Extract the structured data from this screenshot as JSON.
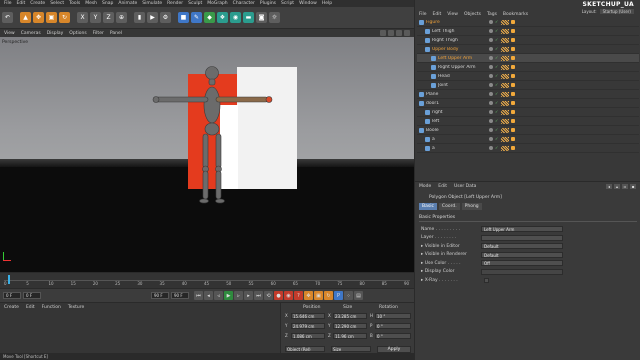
{
  "menubar": [
    "File",
    "Edit",
    "Create",
    "Select",
    "Tools",
    "Mesh",
    "Snap",
    "Animate",
    "Simulate",
    "Render",
    "Sculpt",
    "MoGraph",
    "Character",
    "Plugins",
    "Script",
    "Window",
    "Help"
  ],
  "toolbar": {
    "buttons": [
      {
        "icon": "undo-icon",
        "glyph": "↶",
        "color": "gr"
      },
      {
        "icon": "pointer-icon",
        "glyph": "▲",
        "color": "o"
      },
      {
        "icon": "move-icon",
        "glyph": "✥",
        "color": "o"
      },
      {
        "icon": "scale-icon",
        "glyph": "▣",
        "color": "o"
      },
      {
        "icon": "rotate-icon",
        "glyph": "↻",
        "color": "o"
      },
      {
        "icon": "x-axis-icon",
        "glyph": "X",
        "color": "gr"
      },
      {
        "icon": "y-axis-icon",
        "glyph": "Y",
        "color": "gr"
      },
      {
        "icon": "z-axis-icon",
        "glyph": "Z",
        "color": "gr"
      },
      {
        "icon": "coordinate-system-icon",
        "glyph": "⊕",
        "color": "gr"
      },
      {
        "icon": "render-region-icon",
        "glyph": "▮",
        "color": "gr"
      },
      {
        "icon": "render-view-icon",
        "glyph": "▶",
        "color": "gr"
      },
      {
        "icon": "render-settings-icon",
        "glyph": "⚙",
        "color": "gr"
      },
      {
        "icon": "cube-icon",
        "glyph": "■",
        "color": "b"
      },
      {
        "icon": "pen-icon",
        "glyph": "✎",
        "color": "b"
      },
      {
        "icon": "subdivision-icon",
        "glyph": "◆",
        "color": "g"
      },
      {
        "icon": "array-icon",
        "glyph": "❖",
        "color": "t"
      },
      {
        "icon": "deformer-icon",
        "glyph": "◉",
        "color": "t"
      },
      {
        "icon": "floor-icon",
        "glyph": "▬",
        "color": "t"
      },
      {
        "icon": "camera-icon",
        "glyph": "◙",
        "color": "gr"
      },
      {
        "icon": "light-icon",
        "glyph": "☼",
        "color": "gr"
      }
    ]
  },
  "viewport": {
    "menu": [
      "View",
      "Cameras",
      "Display",
      "Options",
      "Filter",
      "Panel"
    ],
    "label": "Perspective"
  },
  "object_manager": {
    "brand": "SKETCHUP_UA",
    "layout_label": "Layout:",
    "layout_value": "Startup (User)",
    "menu": [
      "File",
      "Edit",
      "View",
      "Objects",
      "Tags",
      "Bookmarks"
    ],
    "rows": [
      {
        "label": "Figure",
        "indent": 0,
        "orange": true,
        "selected": false
      },
      {
        "label": "Left Thigh",
        "indent": 1,
        "orange": false,
        "selected": false
      },
      {
        "label": "Right Thigh",
        "indent": 1,
        "orange": false,
        "selected": false
      },
      {
        "label": "Upper Body",
        "indent": 1,
        "orange": true,
        "selected": false
      },
      {
        "label": "Left Upper Arm",
        "indent": 2,
        "orange": true,
        "selected": true
      },
      {
        "label": "Right Upper Arm",
        "indent": 2,
        "orange": false,
        "selected": false
      },
      {
        "label": "Head",
        "indent": 2,
        "orange": false,
        "selected": false
      },
      {
        "label": "Joint",
        "indent": 2,
        "orange": false,
        "selected": false
      },
      {
        "label": "Plane",
        "indent": 0,
        "orange": false,
        "selected": false
      },
      {
        "label": "door1",
        "indent": 0,
        "orange": false,
        "selected": false
      },
      {
        "label": "right",
        "indent": 1,
        "orange": false,
        "selected": false
      },
      {
        "label": "left",
        "indent": 1,
        "orange": false,
        "selected": false
      },
      {
        "label": "Boole",
        "indent": 0,
        "orange": false,
        "selected": false
      },
      {
        "label": "a",
        "indent": 1,
        "orange": false,
        "selected": false
      },
      {
        "label": "a",
        "indent": 1,
        "orange": false,
        "selected": false
      }
    ]
  },
  "attribute_manager": {
    "menu": [
      "Mode",
      "Edit",
      "User Data"
    ],
    "title": "Polygon Object [Left Upper Arm]",
    "tabs": [
      "Basic",
      "Coord.",
      "Phong"
    ],
    "section": "Basic Properties",
    "props": [
      {
        "label": "Name . . . . . . . . .",
        "value": "Left Upper Arm",
        "dim": false
      },
      {
        "label": "Layer . . . . . . . .",
        "value": "",
        "dim": false
      },
      {
        "label": "▸ Visible in Editor",
        "value": "Default",
        "dim": false
      },
      {
        "label": "▸ Visible in Renderer",
        "value": "Default",
        "dim": false
      },
      {
        "label": "▸ Use Color . . . . .",
        "value": "Off",
        "dim": false
      },
      {
        "label": "▸ Display Color",
        "value": "",
        "dim": true
      },
      {
        "label": "▸ X-Ray . . . . . . .",
        "value": "",
        "dim": false
      }
    ]
  },
  "timeline": {
    "labels": [
      "0",
      "5",
      "10",
      "15",
      "20",
      "25",
      "30",
      "35",
      "40",
      "45",
      "50",
      "55",
      "60",
      "65",
      "70",
      "75",
      "80",
      "85",
      "90"
    ],
    "current_frame": 0
  },
  "transport": {
    "start_frame": "0 F",
    "field2": "0 F",
    "end_frame": "90 F",
    "field4": "90 F",
    "buttons": [
      {
        "icon": "go-start-icon",
        "glyph": "⏮",
        "color": ""
      },
      {
        "icon": "prev-key-icon",
        "glyph": "◂",
        "color": ""
      },
      {
        "icon": "prev-frame-icon",
        "glyph": "◃",
        "color": ""
      },
      {
        "icon": "play-icon",
        "glyph": "▶",
        "color": "g"
      },
      {
        "icon": "next-frame-icon",
        "glyph": "▹",
        "color": ""
      },
      {
        "icon": "next-key-icon",
        "glyph": "▸",
        "color": ""
      },
      {
        "icon": "go-end-icon",
        "glyph": "⏭",
        "color": ""
      },
      {
        "icon": "loop-icon",
        "glyph": "⟲",
        "color": ""
      },
      {
        "icon": "record-icon",
        "glyph": "●",
        "color": "r"
      },
      {
        "icon": "autokey-icon",
        "glyph": "◉",
        "color": "r"
      },
      {
        "icon": "keyframe-selection-icon",
        "glyph": "?",
        "color": "r"
      },
      {
        "icon": "position-key-icon",
        "glyph": "✥",
        "color": "o"
      },
      {
        "icon": "scale-key-icon",
        "glyph": "▣",
        "color": "o"
      },
      {
        "icon": "rotation-key-icon",
        "glyph": "↻",
        "color": "o"
      },
      {
        "icon": "param-key-icon",
        "glyph": "P",
        "color": "b"
      },
      {
        "icon": "point-key-icon",
        "glyph": "⁘",
        "color": ""
      },
      {
        "icon": "timeline-icon",
        "glyph": "▤",
        "color": ""
      }
    ]
  },
  "material_manager": {
    "menu": [
      "Create",
      "Edit",
      "Function",
      "Texture"
    ]
  },
  "coordinates": {
    "headers": [
      "Position",
      "Size",
      "Rotation"
    ],
    "rows": [
      {
        "axis": "X",
        "pos": "15.646 cm",
        "size_axis": "X",
        "size": "23.285 cm",
        "rot_axis": "H",
        "rot": "10 °"
      },
      {
        "axis": "Y",
        "pos": "24.979 cm",
        "size_axis": "Y",
        "size": "12.290 cm",
        "rot_axis": "P",
        "rot": "0 °"
      },
      {
        "axis": "Z",
        "pos": "1.086 cm",
        "size_axis": "Z",
        "size": "11.96 cm",
        "rot_axis": "B",
        "rot": "0 °"
      }
    ],
    "mode": "Object (Rel)",
    "size_mode": "Size",
    "apply": "Apply"
  },
  "statusbar": "Move Tool [Shortcut E]"
}
